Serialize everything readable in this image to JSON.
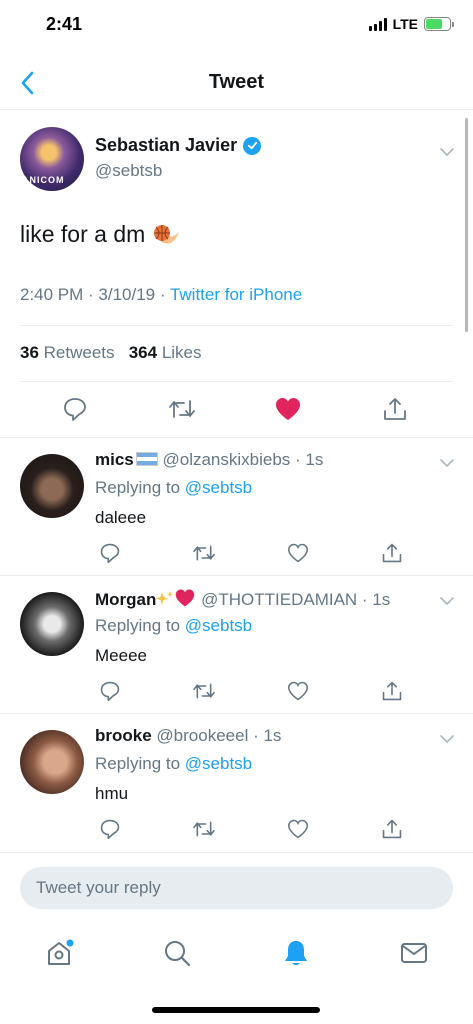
{
  "status_bar": {
    "time": "2:41",
    "network": "LTE"
  },
  "nav": {
    "title": "Tweet"
  },
  "main_tweet": {
    "name": "Sebastian Javier",
    "handle": "@sebtsb",
    "avatar_text": "ANICOM",
    "text": "like for a dm",
    "emoji_icon": "basketball-fire-icon",
    "meta_time": "2:40 PM · 3/10/19 · ",
    "meta_source": "Twitter for iPhone",
    "retweets_count": "36",
    "retweets_label": "Retweets",
    "likes_count": "364",
    "likes_label": "Likes",
    "liked": true
  },
  "replies": [
    {
      "name": "mics",
      "handle": "@olzanskixbiebs · 1s",
      "replying_label": "Replying to",
      "replying_to": "@sebtsb",
      "text": "daleee"
    },
    {
      "name": "Morgan",
      "handle": "@THOTTIEDAMIAN · 1s",
      "replying_label": "Replying to",
      "replying_to": "@sebtsb",
      "text": "Meeee"
    },
    {
      "name": "brooke",
      "handle": "@brookeeel · 1s",
      "replying_label": "Replying to",
      "replying_to": "@sebtsb",
      "text": "hmu"
    }
  ],
  "reply_box": {
    "placeholder": "Tweet your reply"
  },
  "tabs": [
    "home-icon",
    "search-icon",
    "notifications-icon",
    "messages-icon"
  ],
  "colors": {
    "accent": "#1da1f2",
    "like": "#e0245e",
    "muted": "#657786",
    "divider": "#e6ecf0"
  }
}
